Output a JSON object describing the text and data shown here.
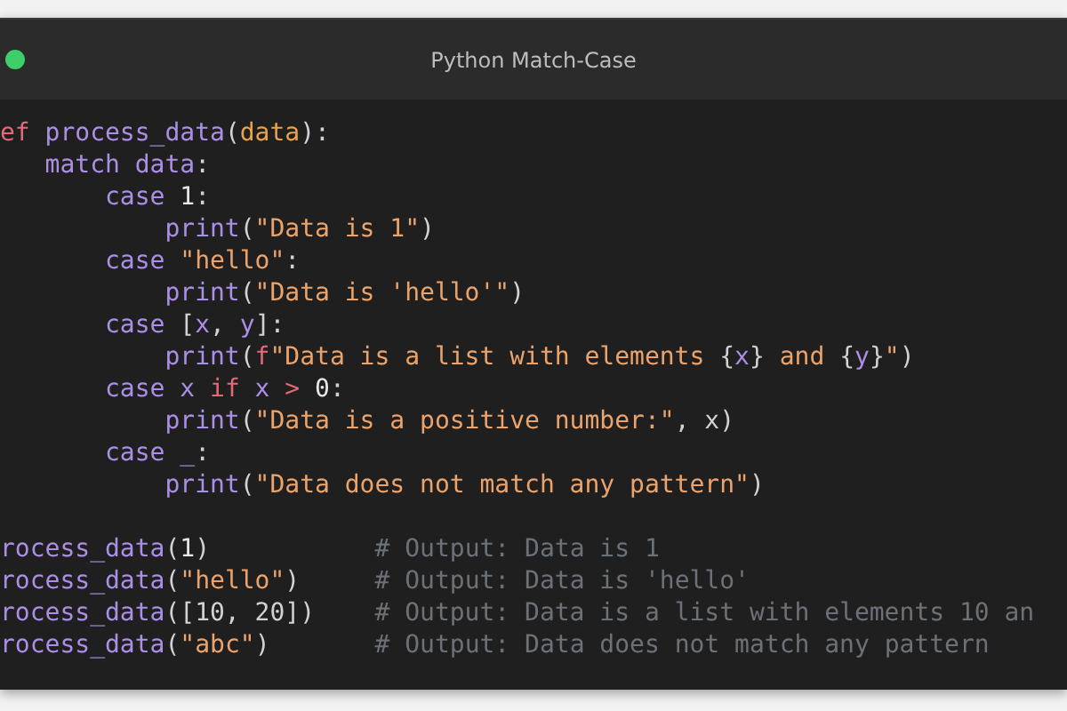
{
  "window": {
    "title": "Python Match-Case"
  },
  "code_lines": [
    {
      "kind": "code",
      "tokens": [
        {
          "kind": "keyword2",
          "text": "ef"
        },
        {
          "kind": "plain",
          "text": " process_data"
        },
        {
          "kind": "punc",
          "text": "("
        },
        {
          "kind": "param",
          "text": "data"
        },
        {
          "kind": "punc",
          "text": "):"
        }
      ]
    },
    {
      "kind": "code",
      "tokens": [
        {
          "kind": "plain",
          "text": "   match data"
        },
        {
          "kind": "punc",
          "text": ":"
        }
      ]
    },
    {
      "kind": "code",
      "tokens": [
        {
          "kind": "plain",
          "text": "       case "
        },
        {
          "kind": "number",
          "text": "1"
        },
        {
          "kind": "punc",
          "text": ":"
        }
      ]
    },
    {
      "kind": "code",
      "tokens": [
        {
          "kind": "plain",
          "text": "           print"
        },
        {
          "kind": "punc",
          "text": "("
        },
        {
          "kind": "string",
          "text": "\"Data is 1\""
        },
        {
          "kind": "punc",
          "text": ")"
        }
      ]
    },
    {
      "kind": "code",
      "tokens": [
        {
          "kind": "plain",
          "text": "       case "
        },
        {
          "kind": "string",
          "text": "\"hello\""
        },
        {
          "kind": "punc",
          "text": ":"
        }
      ]
    },
    {
      "kind": "code",
      "tokens": [
        {
          "kind": "plain",
          "text": "           print"
        },
        {
          "kind": "punc",
          "text": "("
        },
        {
          "kind": "string",
          "text": "\"Data is 'hello'\""
        },
        {
          "kind": "punc",
          "text": ")"
        }
      ]
    },
    {
      "kind": "code",
      "tokens": [
        {
          "kind": "plain",
          "text": "       case "
        },
        {
          "kind": "punc",
          "text": "["
        },
        {
          "kind": "plain",
          "text": "x"
        },
        {
          "kind": "punc",
          "text": ", "
        },
        {
          "kind": "plain",
          "text": "y"
        },
        {
          "kind": "punc",
          "text": "]:"
        }
      ]
    },
    {
      "kind": "code",
      "tokens": [
        {
          "kind": "plain",
          "text": "           print"
        },
        {
          "kind": "punc",
          "text": "("
        },
        {
          "kind": "keyword2",
          "text": "f"
        },
        {
          "kind": "string",
          "text": "\"Data is a list with elements "
        },
        {
          "kind": "punc",
          "text": "{"
        },
        {
          "kind": "plain",
          "text": "x"
        },
        {
          "kind": "punc",
          "text": "}"
        },
        {
          "kind": "string",
          "text": " and "
        },
        {
          "kind": "punc",
          "text": "{"
        },
        {
          "kind": "plain",
          "text": "y"
        },
        {
          "kind": "punc",
          "text": "}"
        },
        {
          "kind": "string",
          "text": "\""
        },
        {
          "kind": "punc",
          "text": ")"
        }
      ]
    },
    {
      "kind": "code",
      "tokens": [
        {
          "kind": "plain",
          "text": "       case x "
        },
        {
          "kind": "keyword2",
          "text": "if"
        },
        {
          "kind": "plain",
          "text": " x "
        },
        {
          "kind": "keyword2",
          "text": ">"
        },
        {
          "kind": "number",
          "text": " 0"
        },
        {
          "kind": "punc",
          "text": ":"
        }
      ]
    },
    {
      "kind": "code",
      "tokens": [
        {
          "kind": "plain",
          "text": "           print"
        },
        {
          "kind": "punc",
          "text": "("
        },
        {
          "kind": "string",
          "text": "\"Data is a positive number:\""
        },
        {
          "kind": "punc",
          "text": ", x)"
        }
      ]
    },
    {
      "kind": "code",
      "tokens": [
        {
          "kind": "plain",
          "text": "       case _"
        },
        {
          "kind": "punc",
          "text": ":"
        }
      ]
    },
    {
      "kind": "code",
      "tokens": [
        {
          "kind": "plain",
          "text": "           print"
        },
        {
          "kind": "punc",
          "text": "("
        },
        {
          "kind": "string",
          "text": "\"Data does not match any pattern\""
        },
        {
          "kind": "punc",
          "text": ")"
        }
      ]
    },
    {
      "kind": "blank"
    },
    {
      "kind": "code",
      "tokens": [
        {
          "kind": "plain",
          "text": "rocess_data"
        },
        {
          "kind": "punc",
          "text": "("
        },
        {
          "kind": "number",
          "text": "1"
        },
        {
          "kind": "punc",
          "text": ")           "
        },
        {
          "kind": "comment",
          "text": "# Output: Data is 1"
        }
      ]
    },
    {
      "kind": "code",
      "tokens": [
        {
          "kind": "plain",
          "text": "rocess_data"
        },
        {
          "kind": "punc",
          "text": "("
        },
        {
          "kind": "string",
          "text": "\"hello\""
        },
        {
          "kind": "punc",
          "text": ")     "
        },
        {
          "kind": "comment",
          "text": "# Output: Data is 'hello'"
        }
      ]
    },
    {
      "kind": "code",
      "tokens": [
        {
          "kind": "plain",
          "text": "rocess_data"
        },
        {
          "kind": "punc",
          "text": "([10, 20])    "
        },
        {
          "kind": "comment",
          "text": "# Output: Data is a list with elements 10 an"
        }
      ]
    },
    {
      "kind": "code",
      "tokens": [
        {
          "kind": "plain",
          "text": "rocess_data"
        },
        {
          "kind": "punc",
          "text": "("
        },
        {
          "kind": "string",
          "text": "\"abc\""
        },
        {
          "kind": "punc",
          "text": ")       "
        },
        {
          "kind": "comment",
          "text": "# Output: Data does not match any pattern"
        }
      ]
    }
  ]
}
